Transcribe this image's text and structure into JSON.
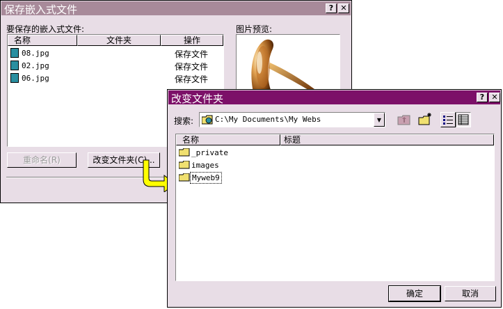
{
  "back_dialog": {
    "title": "保存嵌入式文件",
    "help_button": "?",
    "close_button": "✕",
    "files_label": "要保存的嵌入式文件:",
    "columns": [
      "名称",
      "文件夹",
      "操作"
    ],
    "rows": [
      {
        "name": "08.jpg",
        "folder": "",
        "action": "保存文件"
      },
      {
        "name": "02.jpg",
        "folder": "",
        "action": "保存文件"
      },
      {
        "name": "06.jpg",
        "folder": "",
        "action": "保存文件"
      }
    ],
    "preview_label": "图片预览:",
    "rename_button": "重命名(R)",
    "change_folder_button": "改变文件夹(C)..."
  },
  "front_dialog": {
    "title": "改变文件夹",
    "help_button": "?",
    "close_button": "✕",
    "search_label": "搜索:",
    "path_value": "C:\\My Documents\\My Webs",
    "columns": [
      "名称",
      "标题"
    ],
    "folders": [
      {
        "name": "_private",
        "selected": false
      },
      {
        "name": "images",
        "selected": false
      },
      {
        "name": "Myweb9",
        "selected": true
      }
    ],
    "ok_button": "确定",
    "cancel_button": "取消"
  },
  "colors": {
    "back_title": "#a88a9a",
    "front_title": "#7c1068",
    "face": "#e8dde6",
    "arrow": "#ffff00"
  }
}
